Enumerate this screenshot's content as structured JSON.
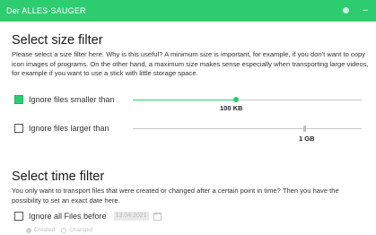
{
  "window": {
    "title": "Der ALLES-SAUGER",
    "accent_color": "#2ecc71"
  },
  "size_filter": {
    "heading": "Select size filter",
    "description": "Please select a size filter here. Why is this useful? A minimum size is important, for example, if you don't want to copy icon images of programs. On the other hand, a maximum size makes sense especially when transporting large videos, for example if you want to use a stick with little storage space.",
    "min_filter": {
      "label": "Ignore files smaller than",
      "checked": true,
      "value_text": "100 KB",
      "slider_fraction": 0.45
    },
    "max_filter": {
      "label": "Ignore files larger than",
      "checked": false,
      "value_text": "1 GB",
      "slider_fraction": 0.75
    }
  },
  "time_filter": {
    "heading": "Select time filter",
    "description": "You only want to transport files that were created or changed after a certain point in time? Then you have the possibility to set an exact date here.",
    "ignore_before": {
      "label": "Ignore all Files before",
      "checked": false,
      "date_value": "13.04.2021"
    },
    "options": [
      {
        "label": "Created",
        "selected": true
      },
      {
        "label": "Changed",
        "selected": false
      }
    ]
  }
}
